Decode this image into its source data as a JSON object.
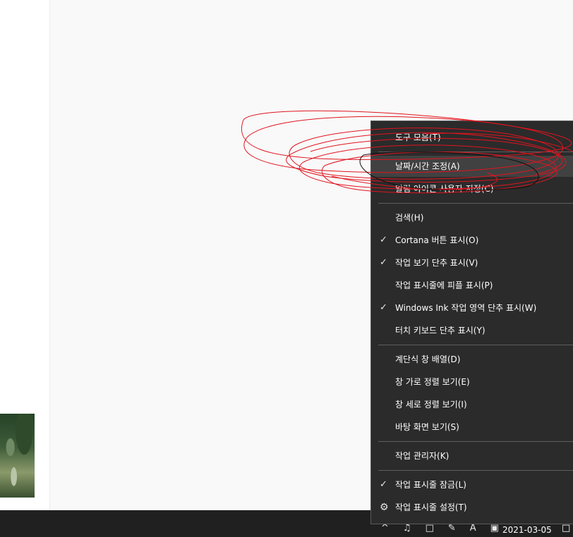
{
  "context_menu": {
    "items": [
      {
        "label": "도구 모음(T)",
        "checked": false
      },
      {
        "label": "날짜/시간 조정(A)",
        "checked": false,
        "highlighted": true
      },
      {
        "label": "알림 아이콘 사용자 지정(C)",
        "checked": false
      },
      {
        "label": "검색(H)",
        "checked": false
      },
      {
        "label": "Cortana 버튼 표시(O)",
        "checked": true
      },
      {
        "label": "작업 보기 단추 표시(V)",
        "checked": true
      },
      {
        "label": "작업 표시줄에 피플 표시(P)",
        "checked": false
      },
      {
        "label": "Windows Ink 작업 영역 단추 표시(W)",
        "checked": true
      },
      {
        "label": "터치 키보드 단추 표시(Y)",
        "checked": false
      },
      {
        "label": "계단식 창 배열(D)",
        "checked": false
      },
      {
        "label": "창 가로 정렬 보기(E)",
        "checked": false
      },
      {
        "label": "창 세로 정렬 보기(I)",
        "checked": false
      },
      {
        "label": "바탕 화면 보기(S)",
        "checked": false
      },
      {
        "label": "작업 관리자(K)",
        "checked": false
      },
      {
        "label": "작업 표시줄 잠금(L)",
        "checked": true
      },
      {
        "label": "작업 표시줄 설정(T)",
        "icon": "gear-icon"
      }
    ]
  },
  "taskbar": {
    "tray_icons": [
      "chevron-up-icon",
      "speaker-icon",
      "network-icon",
      "pen-icon",
      "ime-icon",
      "input-indicator-icon"
    ],
    "ime_label": "A",
    "date": "2021-03-05"
  },
  "colors": {
    "menu_bg": "#2b2b2b",
    "highlight": "#414141",
    "taskbar": "#202020",
    "annotation": "#e0141e"
  }
}
